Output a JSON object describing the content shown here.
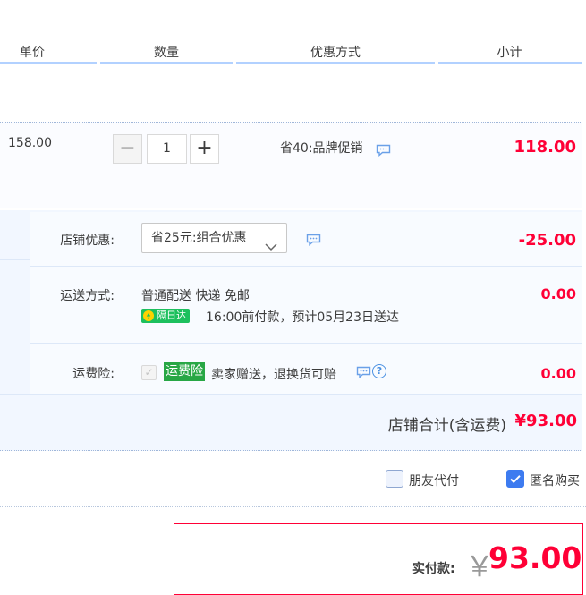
{
  "header": {
    "col_price": "单价",
    "col_qty": "数量",
    "col_promo": "优惠方式",
    "col_subtotal": "小计"
  },
  "item": {
    "unit_price": "158.00",
    "qty_minus": "−",
    "quantity": "1",
    "qty_plus": "+",
    "promotion": "省40:品牌促销",
    "subtotal": "118.00"
  },
  "store": {
    "discount_label": "店铺优惠:",
    "discount_selected": "省25元:组合优惠",
    "discount_amount": "-25.00",
    "shipping_label": "运送方式:",
    "shipping_method": "普通配送 快递 免邮",
    "next_day_badge": "隔日达",
    "delivery_note": "16:00前付款，预计05月23日送达",
    "shipping_amount": "0.00",
    "insurance_label": "运费险:",
    "insurance_check": "✓",
    "insurance_badge": "运费险",
    "insurance_desc": "卖家赠送，退换货可赔",
    "help_mark": "?",
    "insurance_amount": "0.00",
    "total_label": "店铺合计(含运费)",
    "total_amount": "¥93.00"
  },
  "options": {
    "friend_pay_label": "朋友代付",
    "friend_pay_checked": false,
    "anonymous_label": "匿名购买",
    "anonymous_checked": true
  },
  "payment": {
    "label": "实付款:",
    "currency": "￥",
    "amount": "93.00"
  },
  "colors": {
    "accent_red": "#ff0036",
    "header_line": "#b2d1ff",
    "next_day_green": "#1dc05e",
    "checkbox_blue": "#3d7bf0"
  },
  "icons": [
    "chat-bubble-icon",
    "chevron-down-icon",
    "lightning-icon",
    "help-icon",
    "check-icon"
  ]
}
